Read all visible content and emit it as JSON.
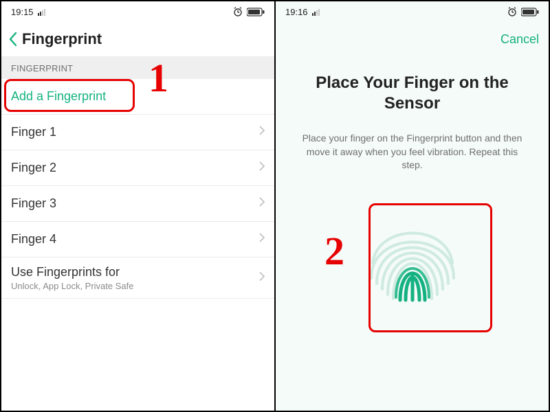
{
  "left": {
    "status": {
      "time": "19:15"
    },
    "header": {
      "title": "Fingerprint"
    },
    "section_label": "FINGERPRINT",
    "add_label": "Add a Fingerprint",
    "fingers": [
      "Finger 1",
      "Finger 2",
      "Finger 3",
      "Finger 4"
    ],
    "use_for": {
      "label": "Use Fingerprints for",
      "sub": "Unlock, App Lock, Private Safe"
    }
  },
  "right": {
    "status": {
      "time": "19:16"
    },
    "cancel": "Cancel",
    "title": "Place Your Finger on the Sensor",
    "desc": "Place your finger on the Fingerprint button and then move it away when you feel vibration. Repeat this step."
  },
  "annotations": {
    "one": "1",
    "two": "2"
  },
  "colors": {
    "accent": "#15b180",
    "callout": "#e60000"
  }
}
